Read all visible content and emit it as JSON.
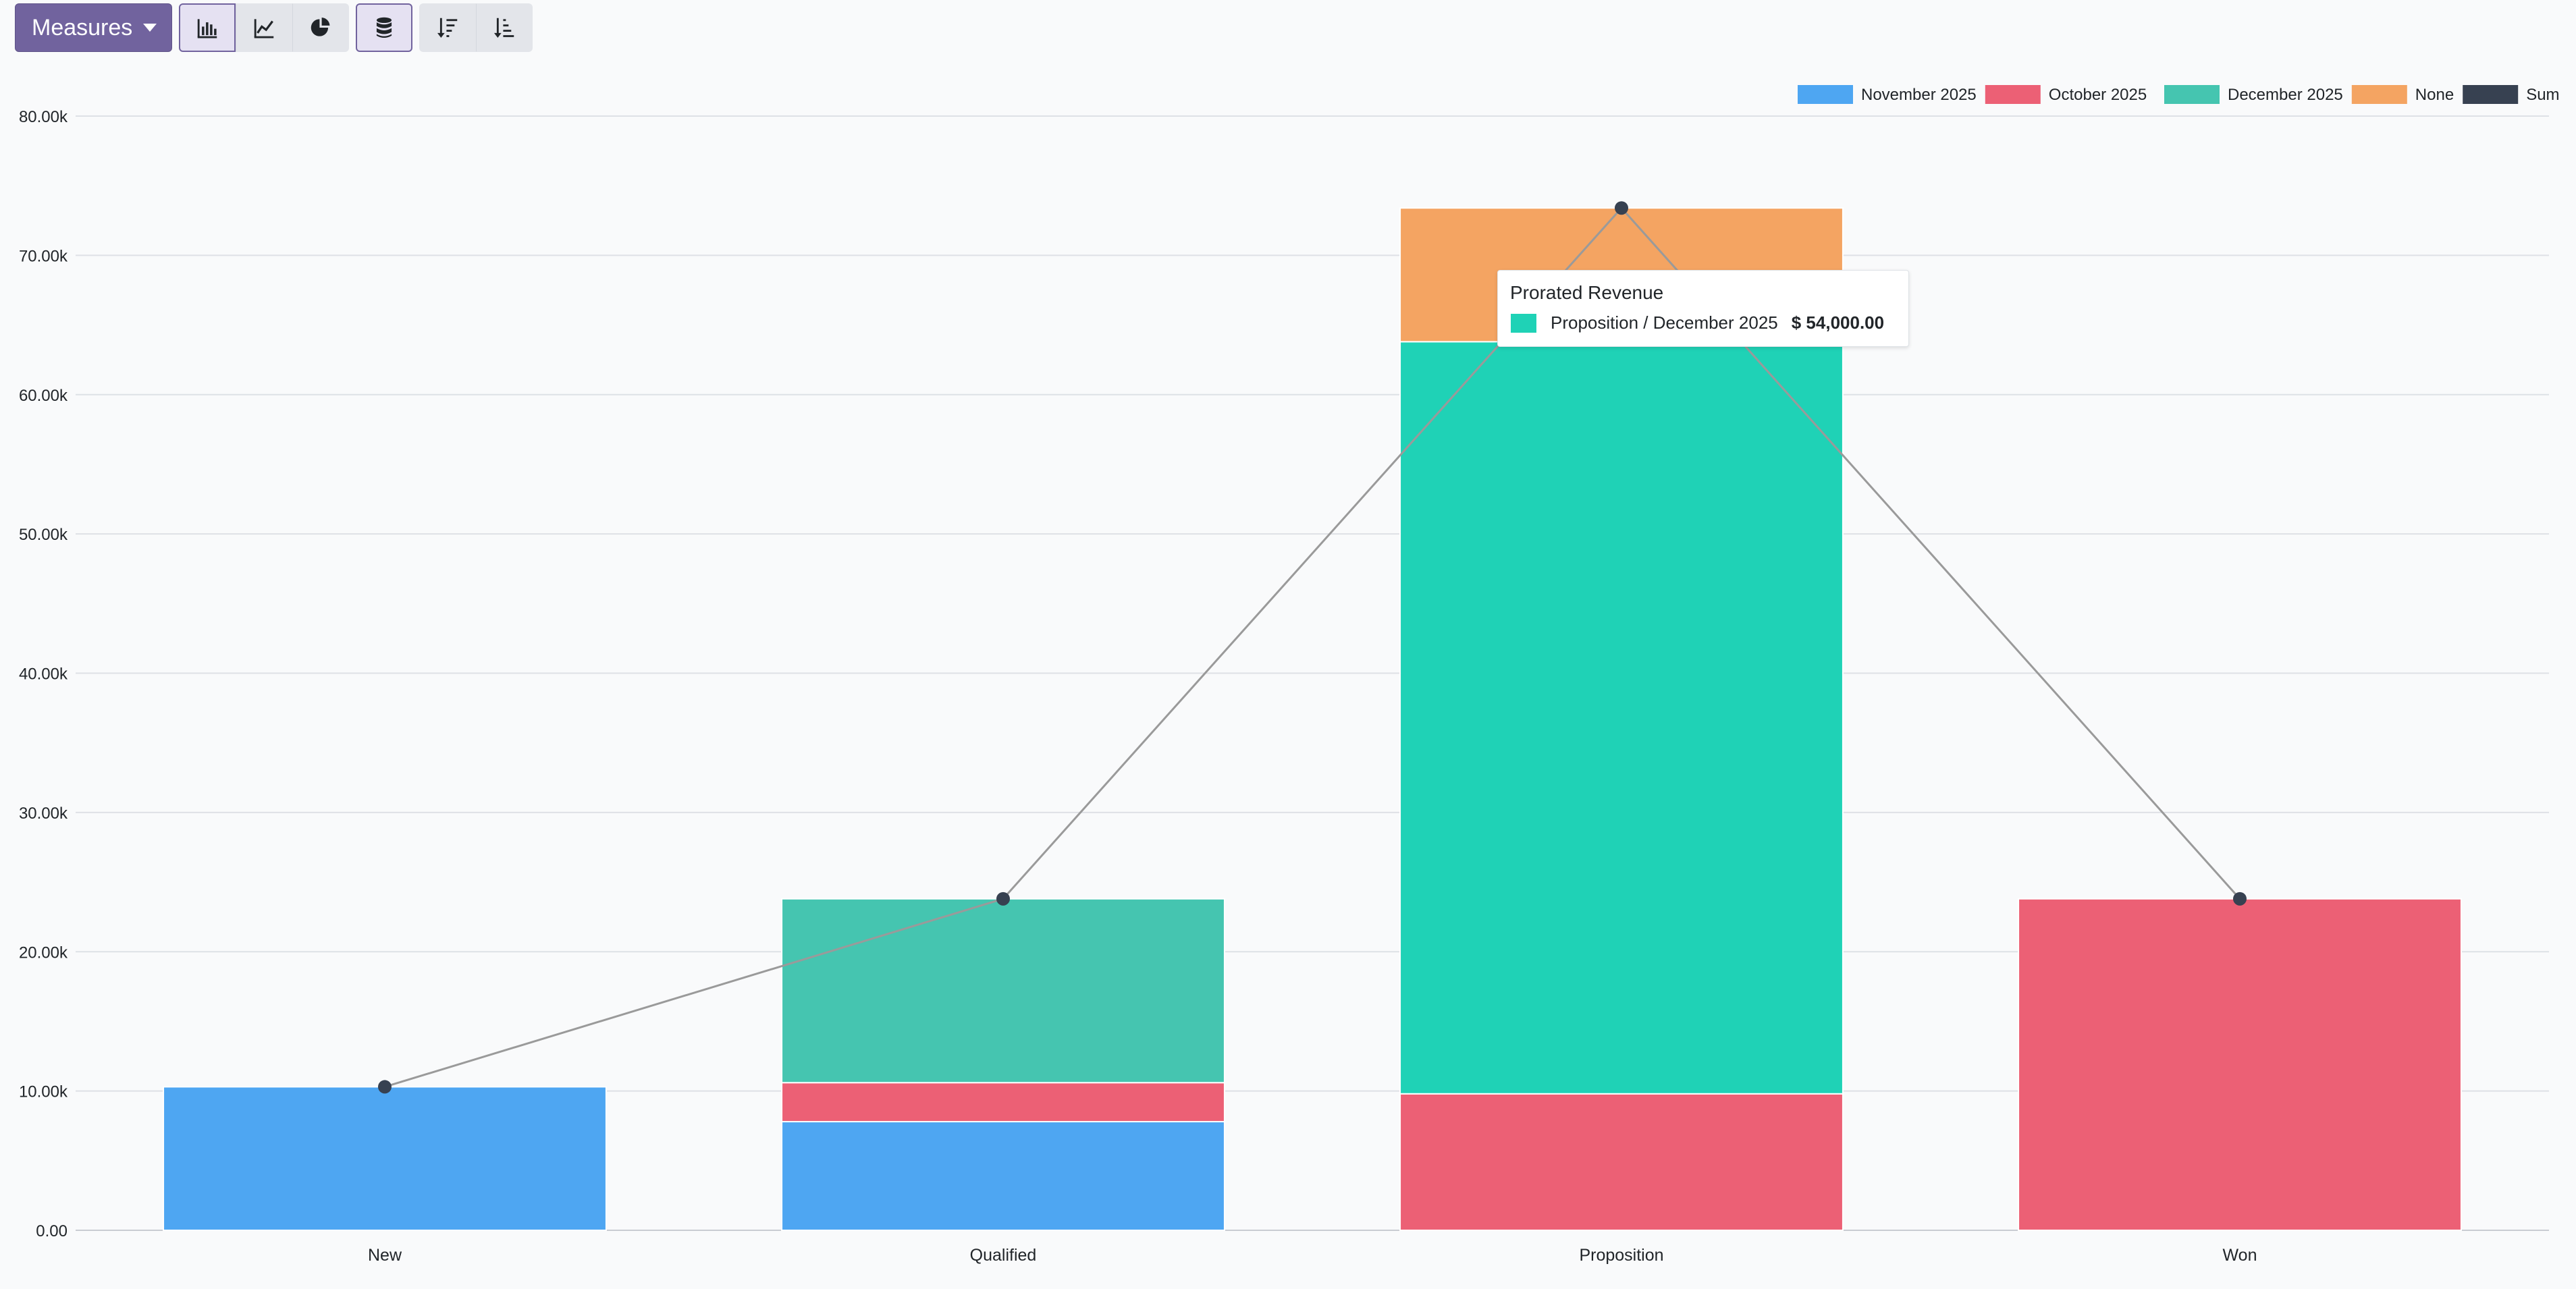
{
  "toolbar": {
    "measures_label": "Measures",
    "buttons": [
      {
        "icon": "bar-chart-icon",
        "active": true
      },
      {
        "icon": "line-chart-icon",
        "active": false
      },
      {
        "icon": "pie-chart-icon",
        "active": false
      },
      {
        "icon": "stacked-database-icon",
        "active": true
      },
      {
        "icon": "sort-descending-icon",
        "active": false
      },
      {
        "icon": "sort-ascending-icon",
        "active": false
      }
    ],
    "accent_color": "#71639e"
  },
  "tooltip": {
    "title": "Prorated Revenue",
    "label": "Proposition / December 2025",
    "value": "$ 54,000.00",
    "color": "#1fd2b6"
  },
  "chart_data": {
    "type": "bar",
    "stacked": true,
    "categories": [
      "New",
      "Qualified",
      "Proposition",
      "Won"
    ],
    "ylim": [
      0,
      80000
    ],
    "yticks": [
      0,
      10000,
      20000,
      30000,
      40000,
      50000,
      60000,
      70000,
      80000
    ],
    "ytick_labels": [
      "0.00",
      "10.00k",
      "20.00k",
      "30.00k",
      "40.00k",
      "50.00k",
      "60.00k",
      "70.00k",
      "80.00k"
    ],
    "grid": true,
    "legend_position": "top-right",
    "series": [
      {
        "name": "November 2025",
        "color": "#4ea6f2",
        "values": [
          10300,
          7800,
          0,
          0
        ]
      },
      {
        "name": "October 2025",
        "color": "#ec6075",
        "values": [
          0,
          2800,
          9800,
          23800
        ]
      },
      {
        "name": "December 2025",
        "color": "#45c5b0",
        "values": [
          0,
          13200,
          54000,
          0
        ]
      },
      {
        "name": "None",
        "color": "#f4a462",
        "values": [
          0,
          0,
          9600,
          0
        ]
      }
    ],
    "sum_series": {
      "name": "Sum",
      "color": "#374151",
      "values": [
        10300,
        23800,
        73400,
        23800
      ]
    },
    "highlight": {
      "category": "Proposition",
      "series": "December 2025",
      "color": "#1fd2b6"
    }
  }
}
